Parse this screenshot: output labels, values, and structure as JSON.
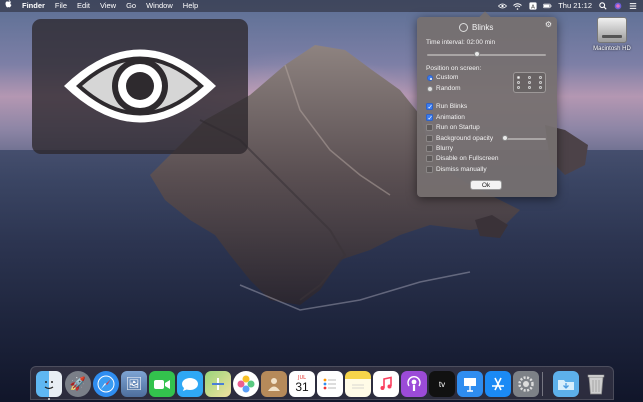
{
  "menubar": {
    "apple_icon": "apple-icon",
    "app_name": "Finder",
    "items": [
      "File",
      "Edit",
      "View",
      "Go",
      "Window",
      "Help"
    ],
    "clock": "Thu 21:12",
    "status_icons": [
      "eye-icon",
      "wifi-icon",
      "accessibility-icon",
      "battery-icon",
      "search-icon",
      "siri-icon",
      "list-icon"
    ]
  },
  "popover": {
    "title": "Blinks",
    "time_interval_label": "Time interval: 02:00 min",
    "time_interval_level": 0.42,
    "position_label": "Position on screen:",
    "radio": {
      "custom": "Custom",
      "random": "Random",
      "selected": "Custom"
    },
    "checkboxes": {
      "run_blinks": {
        "label": "Run Blinks",
        "checked": true
      },
      "animation": {
        "label": "Animation",
        "checked": true
      },
      "run_on_startup": {
        "label": "Run on Startup",
        "checked": false
      },
      "background_opacity": {
        "label": "Background opacity",
        "checked": false
      },
      "blurry": {
        "label": "Blurry",
        "checked": false
      },
      "disable_fullscreen": {
        "label": "Disable on Fullscreen",
        "checked": false
      },
      "dismiss_manually": {
        "label": "Dismiss manually",
        "checked": false
      }
    },
    "opacity_level": 0.0,
    "ok_label": "Ok"
  },
  "desktop": {
    "hd_label": "Macintosh HD"
  },
  "dock": {
    "apps": [
      "Finder",
      "Launchpad",
      "Safari",
      "Preview",
      "FaceTime",
      "Messages",
      "Maps",
      "Photos",
      "Contacts",
      "Calendar",
      "Reminders",
      "Notes",
      "Music",
      "Podcasts",
      "TV",
      "Keynote",
      "App Store",
      "System Preferences",
      "Downloads",
      "Trash"
    ],
    "calendar_month": "JUL",
    "calendar_day": "31"
  },
  "colors": {
    "accent": "#3b7cf0",
    "popover_bg": "#767070"
  }
}
